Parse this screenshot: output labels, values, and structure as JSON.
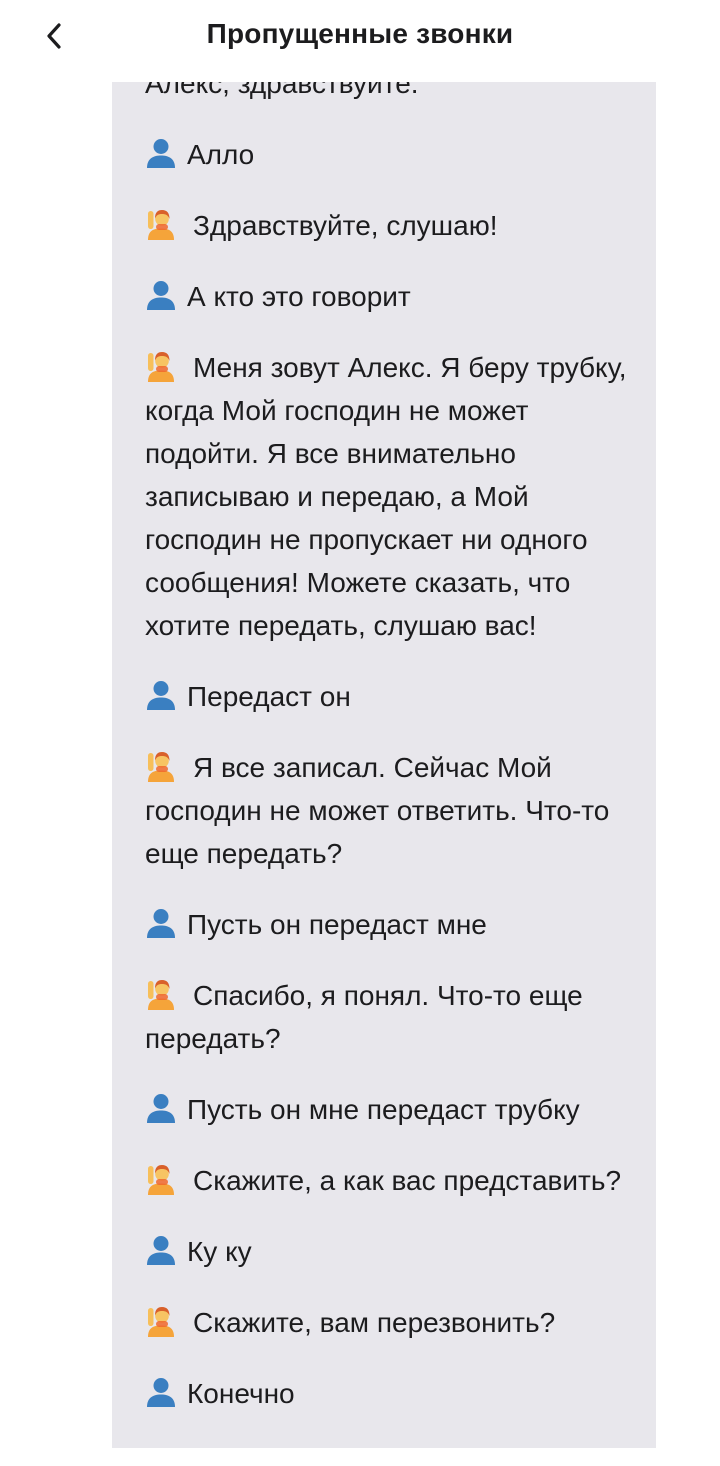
{
  "header": {
    "title": "Пропущенные звонки",
    "back_icon": "chevron-left-icon"
  },
  "icons": {
    "caller": "user-silhouette-icon",
    "assistant": "person-raising-hand-icon"
  },
  "colors": {
    "transcript_bg": "#e8e7ec",
    "caller_icon": "#3a7fc1",
    "assistant_icon": "#f5a43a"
  },
  "transcript": {
    "intro": "Алекс, здравствуйте.",
    "messages": [
      {
        "speaker": "caller",
        "text": "Алло"
      },
      {
        "speaker": "assistant",
        "text": "Здравствуйте, слушаю!"
      },
      {
        "speaker": "caller",
        "text": "А кто это говорит"
      },
      {
        "speaker": "assistant",
        "text": "Меня зовут Алекс. Я беру трубку, когда Мой господин не может подойти. Я все внимательно записываю и передаю, а Мой господин не пропускает ни одного сообщения! Можете сказать, что хотите передать, слушаю вас!"
      },
      {
        "speaker": "caller",
        "text": "Передаст он"
      },
      {
        "speaker": "assistant",
        "text": "Я все записал. Сейчас Мой господин не может ответить. Что-то еще передать?"
      },
      {
        "speaker": "caller",
        "text": "Пусть он передаст мне"
      },
      {
        "speaker": "assistant",
        "text": "Спасибо, я понял. Что-то еще передать?"
      },
      {
        "speaker": "caller",
        "text": "Пусть он мне передаст трубку"
      },
      {
        "speaker": "assistant",
        "text": "Скажите, а как вас представить?"
      },
      {
        "speaker": "caller",
        "text": "Ку ку"
      },
      {
        "speaker": "assistant",
        "text": "Скажите, вам перезвонить?"
      },
      {
        "speaker": "caller",
        "text": "Конечно"
      }
    ]
  }
}
